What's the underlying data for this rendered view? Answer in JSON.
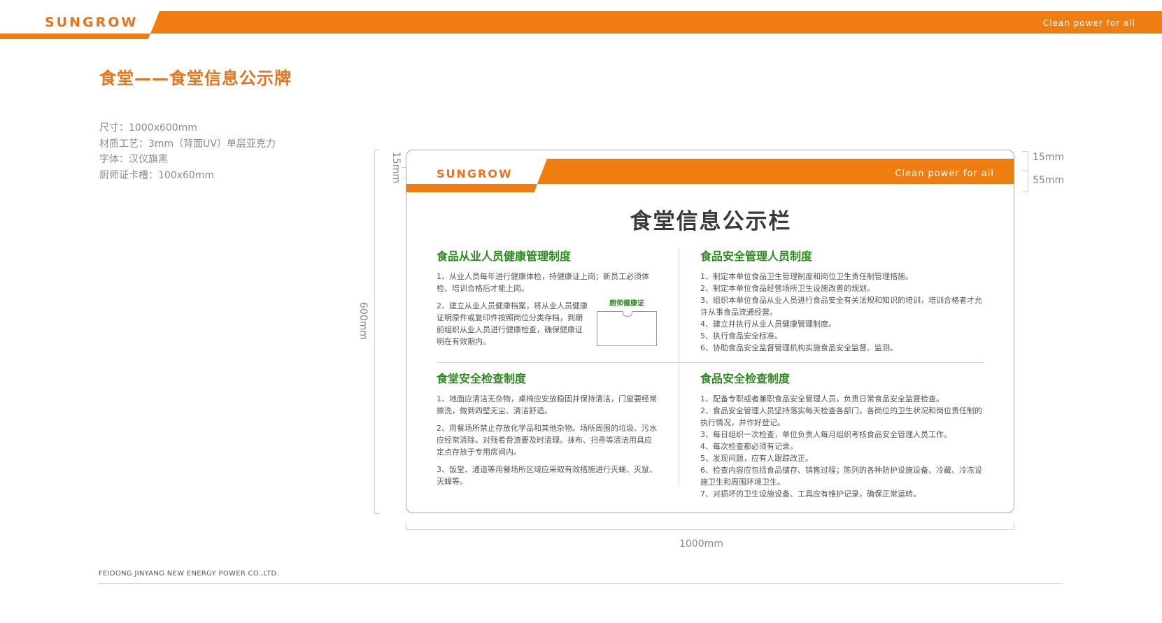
{
  "header": {
    "brand": "SUNGROW",
    "slogan": "Clean power for all",
    "accent_color": "#e8731a"
  },
  "page_title": "食堂——食堂信息公示牌",
  "specs": [
    "尺寸：1000x600mm",
    "材质工艺：3mm（背面UV）单层亚克力",
    "字体：汉仪旗黑",
    "厨师证卡槽：100x60mm"
  ],
  "dimensions": {
    "top_left": "15mm",
    "right_top": "15mm",
    "right_band": "55mm",
    "height": "600mm",
    "width": "1000mm"
  },
  "board": {
    "brand": "SUNGROW",
    "slogan": "Clean power for all",
    "title": "食堂信息公示栏",
    "section_color": "#2e8b1f",
    "card_label": "厨师健康证",
    "sections": {
      "health": {
        "title": "食品从业人员健康管理制度",
        "items": [
          "1、从业人员每年进行健康体检，持健康证上岗；新员工必须体检、培训合格后才能上岗。",
          "2、建立从业人员健康档案，将从业人员健康证明原件或复印件按照岗位分类存档，到期前组织从业人员进行健康检查，确保健康证明在有效期内。"
        ]
      },
      "safety_staff": {
        "title": "食品安全管理人员制度",
        "items": [
          "1、制定本单位食品卫生管理制度和岗位卫生责任制管理措施。",
          "2、制定本单位食品经营场所卫生设施改善的规划。",
          "3、组织本单位食品从业人员进行食品安全有关法规和知识的培训，培训合格者才允许从事食品流通经营。",
          "4、建立并执行从业人员健康管理制度。",
          "5、执行食品安全标准。",
          "6、协助食品安全监督管理机构实施食品安全监督、监测。"
        ]
      },
      "canteen_check": {
        "title": "食堂安全检查制度",
        "items": [
          "1、地面应清洁无杂物，桌椅应安放稳固并保持清洁，门窗要经常擦洗，做到四壁无尘、清洁舒适。",
          "2、用餐场所禁止存放化学品和其他杂物。场所周围的垃圾、污水应经常清除。对残肴骨渣要及时清理。抹布、扫帚等清洁用具应定点存放于专用房间内。",
          "3、饭堂、通道等用餐场所区域应采取有效措施进行灭蝇、灭鼠、灭蟑等。"
        ]
      },
      "food_check": {
        "title": "食品安全检查制度",
        "items": [
          "1、配备专职或者兼职食品安全管理人员，负责日常食品安全监督检查。",
          "2、食品安全管理人员坚持落实每天检查各部门，各岗位的卫生状况和岗位责任制的执行情况，并作好登记。",
          "3、每日组织一次检查，单位负责人每月组织考核食品安全管理人员工作。",
          "4、每次检查都必须有记录。",
          "5、发现问题，应有人跟踪改正。",
          "6、检查内容应包括食品储存、销售过程；陈列的各种防护设施设备、冷藏、冷冻设施卫生和周围环境卫生。",
          "7、对损坏的卫生设施设备、工具应有维护记录，确保正常运转。"
        ]
      }
    }
  },
  "footer": {
    "company": "FEIDONG JINYANG NEW ENERGY POWER CO.,LTD."
  }
}
